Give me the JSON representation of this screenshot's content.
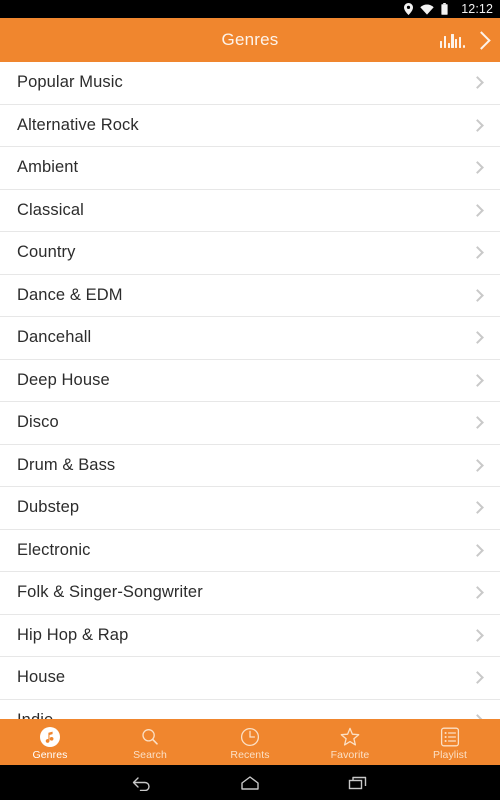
{
  "status_bar": {
    "time": "12:12",
    "icons": [
      "location-pin-icon",
      "wifi-icon",
      "battery-icon"
    ]
  },
  "app_bar": {
    "title": "Genres",
    "background_color": "#F0862E",
    "text_color": "#FDF3EA",
    "actions": [
      {
        "name": "equalizer-icon",
        "label": "Equalizer"
      },
      {
        "name": "chevron-right-icon",
        "label": "Next"
      }
    ]
  },
  "genres": [
    {
      "label": "Popular Music"
    },
    {
      "label": "Alternative Rock"
    },
    {
      "label": "Ambient"
    },
    {
      "label": "Classical"
    },
    {
      "label": "Country"
    },
    {
      "label": "Dance & EDM"
    },
    {
      "label": "Dancehall"
    },
    {
      "label": "Deep House"
    },
    {
      "label": "Disco"
    },
    {
      "label": "Drum & Bass"
    },
    {
      "label": "Dubstep"
    },
    {
      "label": "Electronic"
    },
    {
      "label": "Folk & Singer-Songwriter"
    },
    {
      "label": "Hip Hop & Rap"
    },
    {
      "label": "House"
    },
    {
      "label": "Indie"
    }
  ],
  "tab_bar": {
    "background_color": "#F0862E",
    "active_index": 0,
    "tabs": [
      {
        "label": "Genres",
        "icon": "music-note-icon",
        "active": true
      },
      {
        "label": "Search",
        "icon": "search-icon",
        "active": false
      },
      {
        "label": "Recents",
        "icon": "clock-icon",
        "active": false
      },
      {
        "label": "Favorite",
        "icon": "star-icon",
        "active": false
      },
      {
        "label": "Playlist",
        "icon": "playlist-icon",
        "active": false
      }
    ]
  },
  "nav_bar": {
    "buttons": [
      {
        "name": "back-button",
        "icon": "back-arrow-icon"
      },
      {
        "name": "home-button",
        "icon": "home-icon"
      },
      {
        "name": "recents-button",
        "icon": "recents-squares-icon"
      }
    ]
  }
}
